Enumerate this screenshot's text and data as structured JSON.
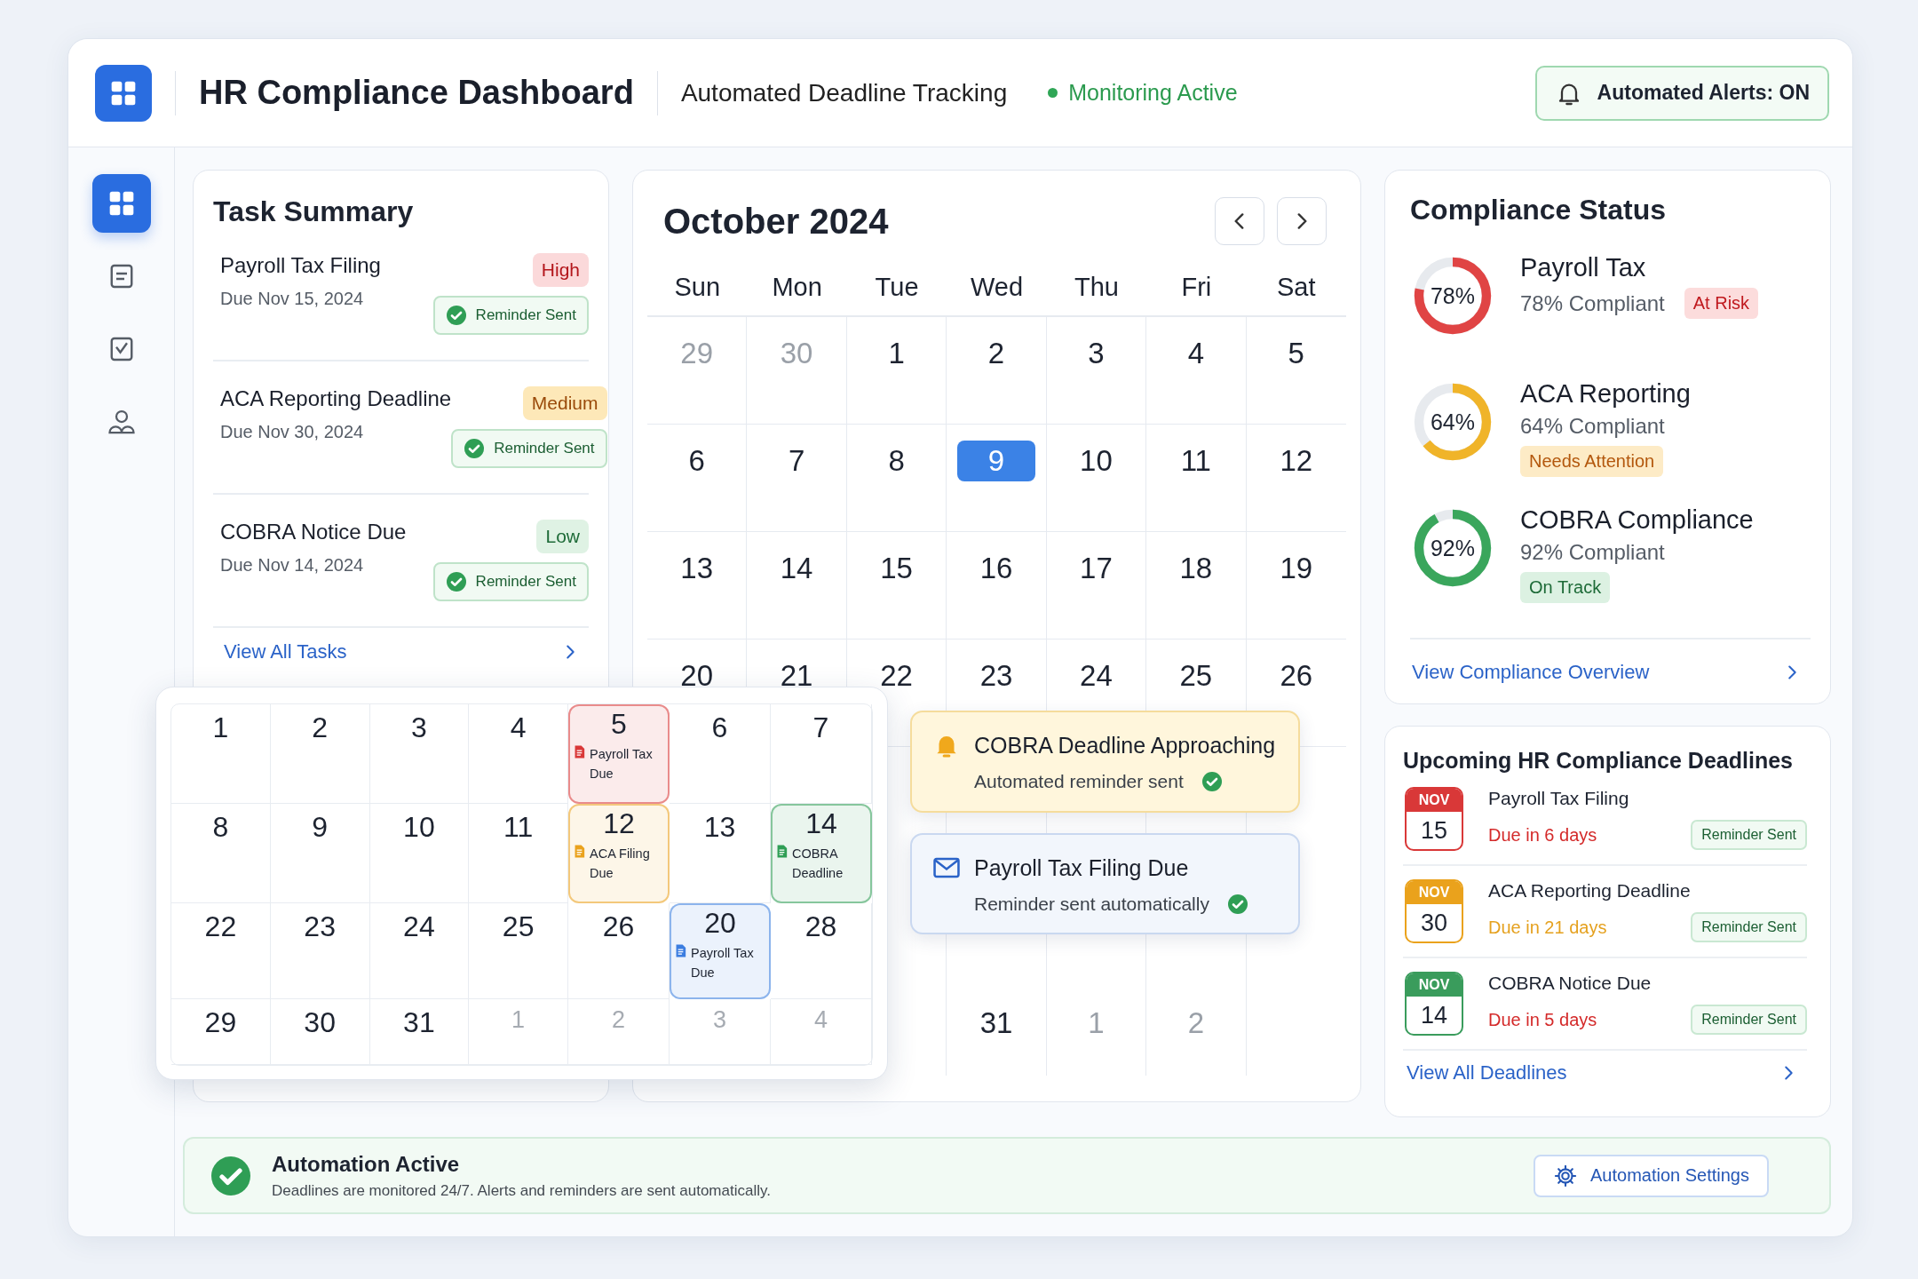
{
  "header": {
    "title": "HR Compliance Dashboard",
    "subtitle": "Automated Deadline Tracking",
    "status": "Monitoring Active",
    "alerts_button": "Automated Alerts: ON"
  },
  "sidebar": {
    "items": [
      {
        "kind": "dashboard",
        "selected": true
      },
      {
        "kind": "document",
        "selected": false
      },
      {
        "kind": "checklist",
        "selected": false
      },
      {
        "kind": "people",
        "selected": false
      }
    ]
  },
  "task_summary": {
    "title": "Task Summary",
    "tasks": [
      {
        "name": "Payroll Tax Filing",
        "due": "Due Nov 15, 2024",
        "priority": "High",
        "kind": "high",
        "reminder": "Reminder Sent"
      },
      {
        "name": "ACA Reporting Deadline",
        "due": "Due Nov 30, 2024",
        "priority": "Medium",
        "kind": "medium",
        "reminder": "Reminder Sent"
      },
      {
        "name": "COBRA Notice Due",
        "due": "Due Nov 14, 2024",
        "priority": "Low",
        "kind": "low",
        "reminder": "Reminder Sent"
      }
    ],
    "link": "View All Tasks"
  },
  "calendar": {
    "title": "October 2024",
    "weekdays": [
      "Sun",
      "Mon",
      "Tue",
      "Wed",
      "Thu",
      "Fri",
      "Sat"
    ],
    "weeks": [
      [
        {
          "day": "29",
          "muted": true,
          "selected": false
        },
        {
          "day": "30",
          "muted": true,
          "selected": false
        },
        {
          "day": "1",
          "muted": false,
          "selected": false
        },
        {
          "day": "2",
          "muted": false,
          "selected": false
        },
        {
          "day": "3",
          "muted": false,
          "selected": false
        },
        {
          "day": "4",
          "muted": false,
          "selected": false
        },
        {
          "day": "5",
          "muted": false,
          "selected": false
        }
      ],
      [
        {
          "day": "6",
          "muted": false,
          "selected": false
        },
        {
          "day": "7",
          "muted": false,
          "selected": false
        },
        {
          "day": "8",
          "muted": false,
          "selected": false
        },
        {
          "day": "9",
          "muted": false,
          "selected": true
        },
        {
          "day": "10",
          "muted": false,
          "selected": false
        },
        {
          "day": "11",
          "muted": false,
          "selected": false
        },
        {
          "day": "12",
          "muted": false,
          "selected": false
        }
      ],
      [
        {
          "day": "13",
          "muted": false,
          "selected": false
        },
        {
          "day": "14",
          "muted": false,
          "selected": false
        },
        {
          "day": "15",
          "muted": false,
          "selected": false
        },
        {
          "day": "16",
          "muted": false,
          "selected": false
        },
        {
          "day": "17",
          "muted": false,
          "selected": false
        },
        {
          "day": "18",
          "muted": false,
          "selected": false
        },
        {
          "day": "19",
          "muted": false,
          "selected": false
        }
      ],
      [
        {
          "day": "20",
          "muted": false,
          "selected": false
        },
        {
          "day": "21",
          "muted": false,
          "selected": false
        },
        {
          "day": "22",
          "muted": false,
          "selected": false
        },
        {
          "day": "23",
          "muted": false,
          "selected": false
        },
        {
          "day": "24",
          "muted": false,
          "selected": false
        },
        {
          "day": "25",
          "muted": false,
          "selected": false
        },
        {
          "day": "26",
          "muted": false,
          "selected": false
        }
      ],
      [
        {
          "day": "31",
          "muted": false,
          "selected": false
        },
        {
          "day": "1",
          "muted": true,
          "selected": false
        },
        {
          "day": "2",
          "muted": true,
          "selected": false
        }
      ]
    ]
  },
  "popup_calendar": {
    "weeks": [
      [
        {
          "day": "1",
          "muted": false
        },
        {
          "day": "2",
          "muted": false
        },
        {
          "day": "3",
          "muted": false
        },
        {
          "day": "4",
          "muted": false
        },
        {
          "day": "5",
          "muted": false,
          "event": {
            "label": "Payroll Tax Due",
            "color": "#d93838"
          }
        },
        {
          "day": "6",
          "muted": false
        },
        {
          "day": "7",
          "muted": false
        }
      ],
      [
        {
          "day": "8",
          "muted": false
        },
        {
          "day": "9",
          "muted": false
        },
        {
          "day": "10",
          "muted": false
        },
        {
          "day": "11",
          "muted": false
        },
        {
          "day": "12",
          "muted": false,
          "event": {
            "label": "ACA Filing Due",
            "color": "#eaa21c"
          }
        },
        {
          "day": "13",
          "muted": false
        },
        {
          "day": "14",
          "muted": false,
          "event": {
            "label": "COBRA Deadline",
            "color": "#2f9e55"
          }
        }
      ],
      [
        {
          "day": "22",
          "muted": false
        },
        {
          "day": "23",
          "muted": false
        },
        {
          "day": "24",
          "muted": false
        },
        {
          "day": "25",
          "muted": false
        },
        {
          "day": "26",
          "muted": false
        },
        {
          "day": "20",
          "muted": false,
          "event": {
            "label": "Payroll Tax Due",
            "color": "#3b7de0"
          }
        },
        {
          "day": "28",
          "muted": false
        }
      ],
      [
        {
          "day": "29",
          "muted": false
        },
        {
          "day": "30",
          "muted": false
        },
        {
          "day": "31",
          "muted": false
        },
        {
          "day": "1",
          "muted": true
        },
        {
          "day": "2",
          "muted": true
        },
        {
          "day": "3",
          "muted": true
        },
        {
          "day": "4",
          "muted": true
        }
      ]
    ]
  },
  "notifications": [
    {
      "kind": "alert",
      "title": "COBRA Deadline Approaching",
      "text": "Automated reminder sent"
    },
    {
      "kind": "email",
      "title": "Payroll Tax Filing Due",
      "text": "Reminder sent automatically"
    }
  ],
  "compliance": {
    "title": "Compliance Status",
    "items": [
      {
        "name": "Payroll Tax",
        "percent": "78%",
        "level": 0.78,
        "color": "#e04444",
        "detail": "78% Compliant",
        "status": "At Risk",
        "kind": "risk"
      },
      {
        "name": "ACA Reporting",
        "percent": "64%",
        "level": 0.64,
        "color": "#f0b429",
        "detail": "64% Compliant",
        "status": "Needs Attention",
        "kind": "attention"
      },
      {
        "name": "COBRA Compliance",
        "percent": "92%",
        "level": 0.92,
        "color": "#3aa65c",
        "detail": "92% Compliant",
        "status": "On Track",
        "kind": "track"
      }
    ],
    "link": "View Compliance Overview"
  },
  "deadlines": {
    "title": "Upcoming HR Compliance Deadlines",
    "items": [
      {
        "month": "NOV",
        "day": "15",
        "color": "#d93838",
        "name": "Payroll Tax Filing",
        "due": "Due in 6 days",
        "kind": "urgent",
        "reminder": "Reminder Sent"
      },
      {
        "month": "NOV",
        "day": "30",
        "color": "#eaa21c",
        "name": "ACA Reporting Deadline",
        "due": "Due in 21 days",
        "kind": "soon",
        "reminder": "Reminder Sent"
      },
      {
        "month": "NOV",
        "day": "14",
        "color": "#3a9c5c",
        "name": "COBRA Notice Due",
        "due": "Due in 5 days",
        "kind": "urgent",
        "reminder": "Reminder Sent"
      }
    ],
    "link": "View All Deadlines"
  },
  "footer": {
    "title": "Automation Active",
    "text": "Deadlines are monitored 24/7. Alerts and reminders are sent automatically.",
    "button": "Automation Settings"
  }
}
